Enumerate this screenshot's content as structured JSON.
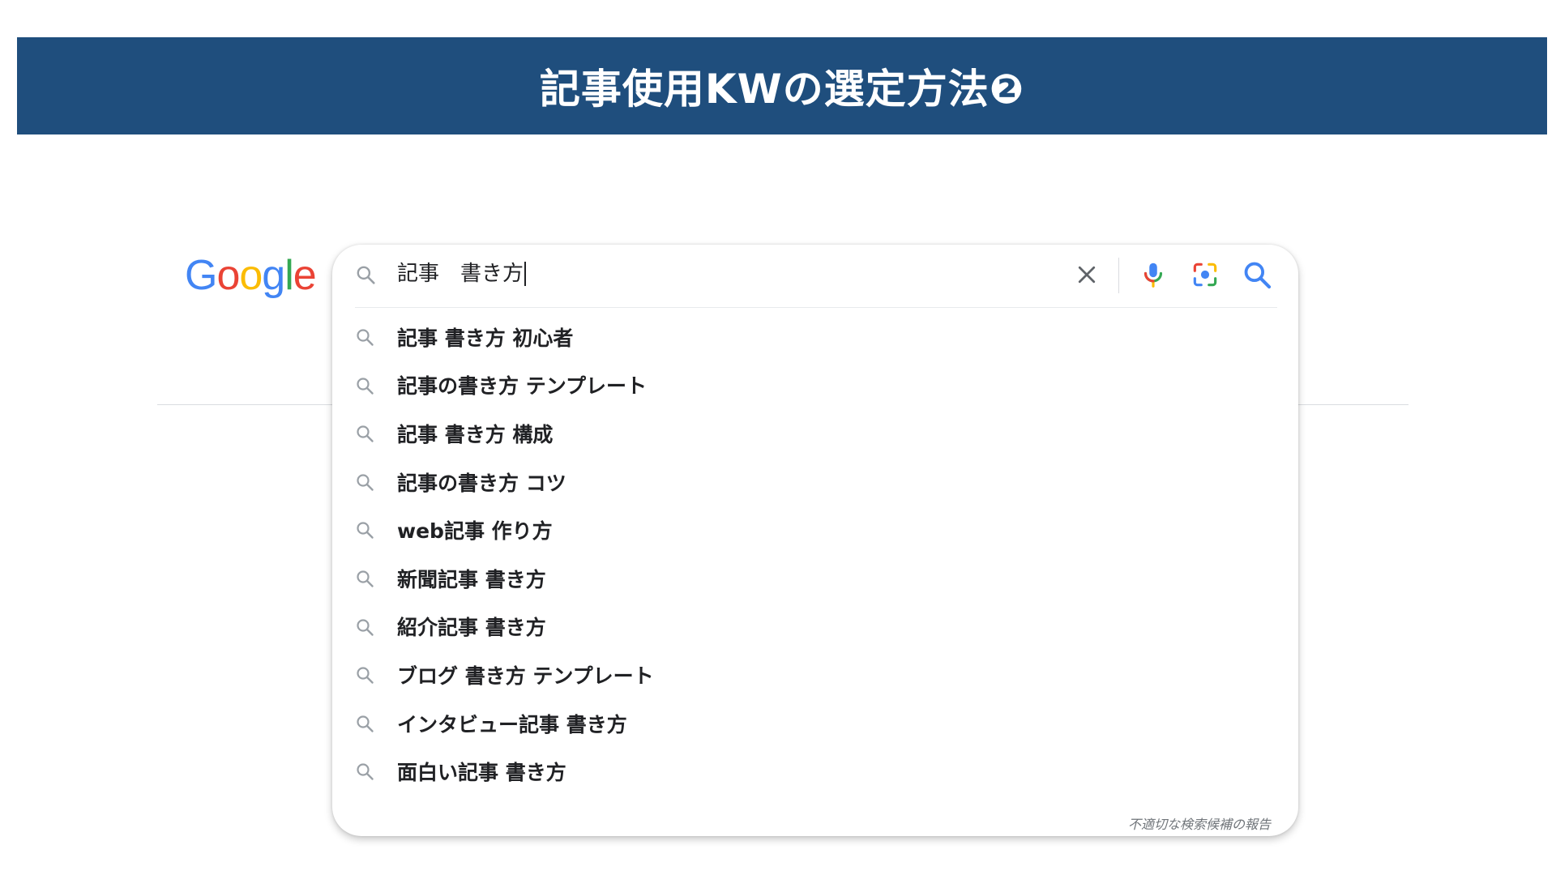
{
  "banner": {
    "title": "記事使用KWの選定方法❷"
  },
  "logo": {
    "letters": [
      "G",
      "o",
      "o",
      "g",
      "l",
      "e"
    ]
  },
  "search": {
    "query": "記事　書き方"
  },
  "suggestions": [
    "記事 書き方 初心者",
    "記事の書き方 テンプレート",
    "記事 書き方 構成",
    "記事の書き方 コツ",
    "web記事 作り方",
    "新聞記事 書き方",
    "紹介記事 書き方",
    "ブログ 書き方 テンプレート",
    "インタビュー記事 書き方",
    "面白い記事 書き方"
  ],
  "report_link": "不適切な検索候補の報告",
  "colors": {
    "banner": "#1f4e7d",
    "google_blue": "#4285f4",
    "google_red": "#ea4335",
    "google_yellow": "#fbbc05",
    "google_green": "#34a853",
    "icon_gray": "#9aa0a6"
  },
  "icons": {
    "lead": "search-icon",
    "clear": "close-icon",
    "voice": "microphone-icon",
    "image": "lens-icon",
    "submit": "search-icon"
  }
}
